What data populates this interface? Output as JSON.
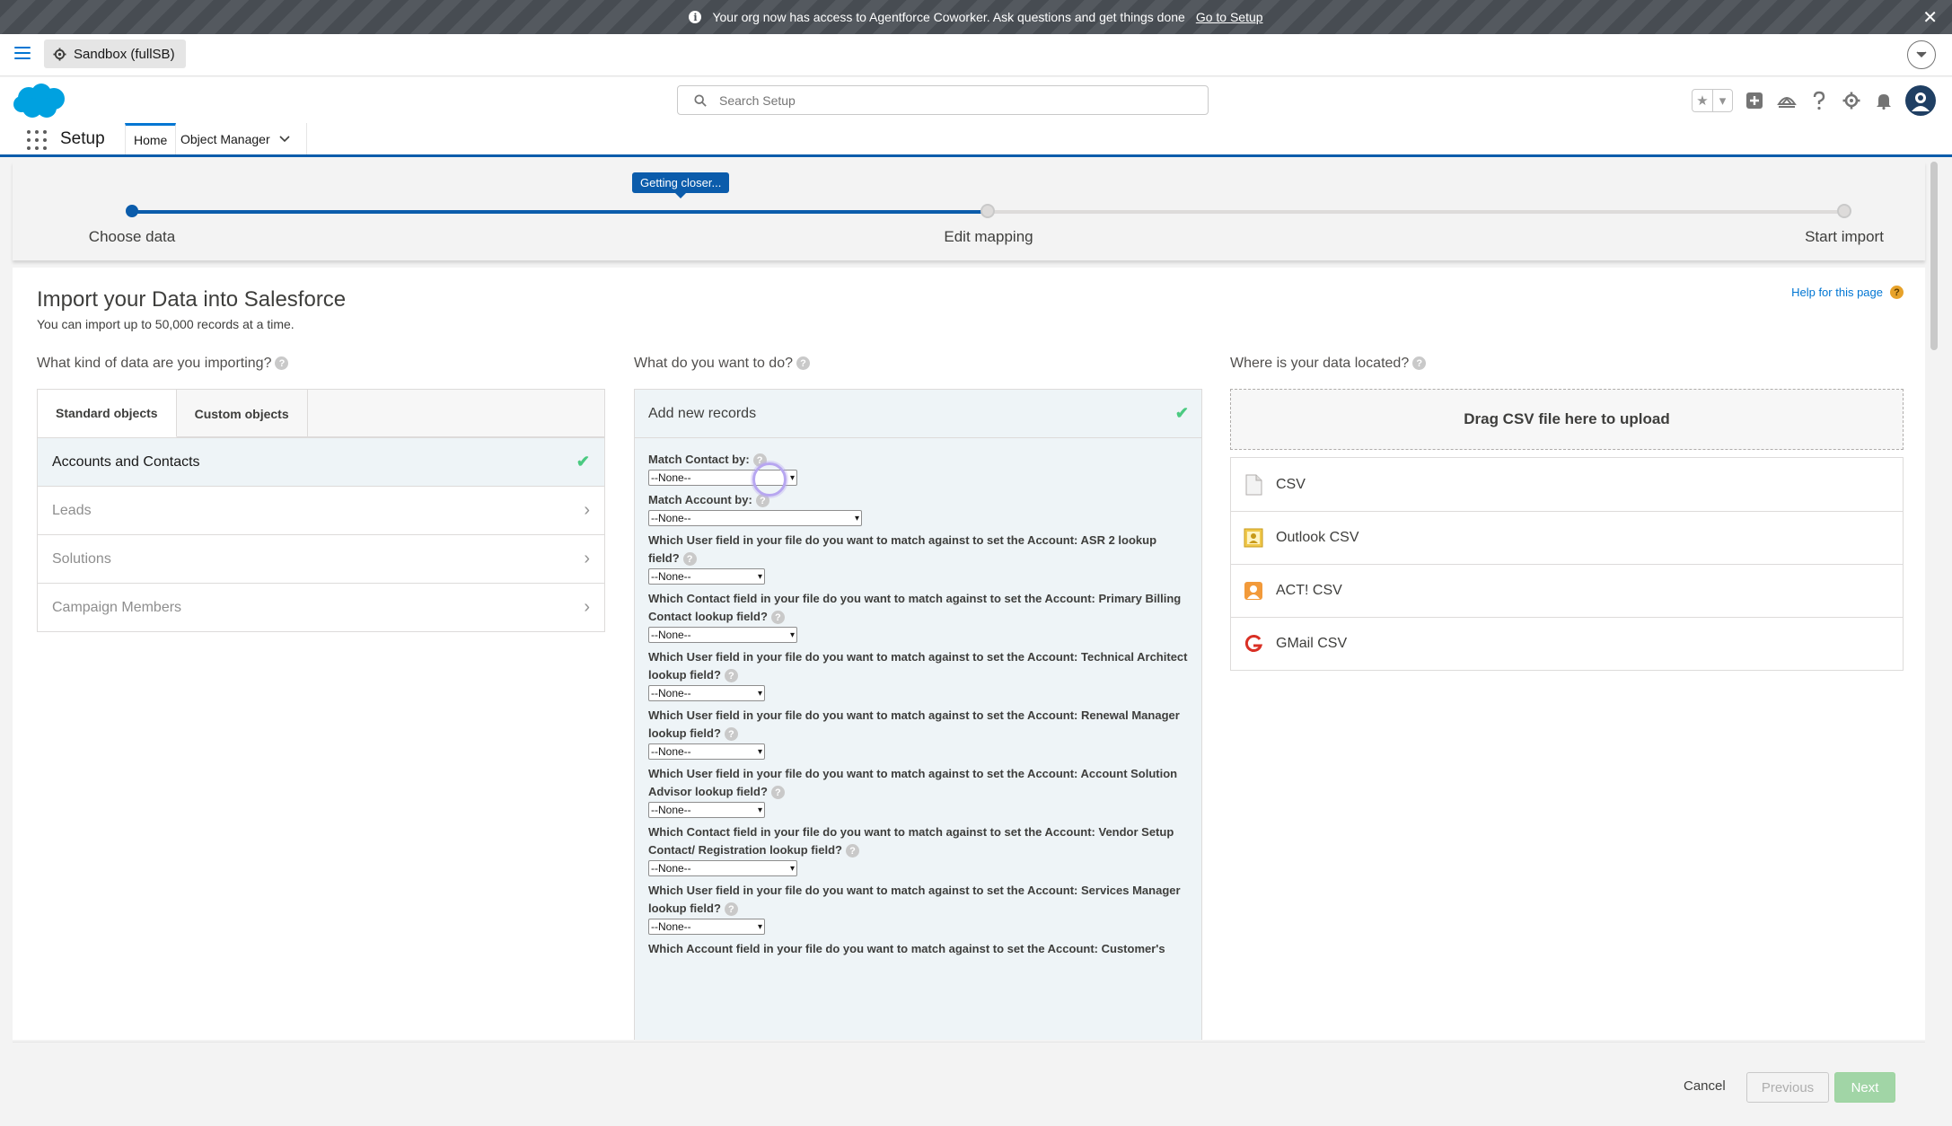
{
  "banner": {
    "message": "Your org now has access to Agentforce Coworker. Ask questions and get things done",
    "link": "Go to Setup"
  },
  "sandbox": {
    "label": "Sandbox (fullSB)"
  },
  "search": {
    "placeholder": "Search Setup"
  },
  "nav": {
    "app_name": "Setup",
    "home": "Home",
    "object_manager": "Object Manager"
  },
  "progress": {
    "tooltip": "Getting closer...",
    "fraction_complete": 0.5,
    "steps": [
      {
        "label": "Choose data"
      },
      {
        "label": "Edit mapping"
      },
      {
        "label": "Start import"
      }
    ]
  },
  "page": {
    "title": "Import your Data into Salesforce",
    "subtitle": "You can import up to 50,000 records at a time.",
    "help": "Help for this page"
  },
  "col1": {
    "question": "What kind of data are you importing?",
    "tabs": [
      "Standard objects",
      "Custom objects"
    ],
    "objects": [
      "Accounts and Contacts",
      "Leads",
      "Solutions",
      "Campaign Members"
    ]
  },
  "col2": {
    "question": "What do you want to do?",
    "action": "Add new records",
    "fields": [
      {
        "label": "Match Contact by:",
        "value": "--None--"
      },
      {
        "label": "Match Account by:",
        "value": "--None--"
      },
      {
        "label": "Which User field in your file do you want to match against to set the Account: ASR 2 lookup field?",
        "value": "--None--"
      },
      {
        "label": "Which Contact field in your file do you want to match against to set the Account: Primary Billing Contact lookup field?",
        "value": "--None--"
      },
      {
        "label": "Which User field in your file do you want to match against to set the Account: Technical Architect lookup field?",
        "value": "--None--"
      },
      {
        "label": "Which User field in your file do you want to match against to set the Account: Renewal Manager lookup field?",
        "value": "--None--"
      },
      {
        "label": "Which User field in your file do you want to match against to set the Account: Account Solution Advisor lookup field?",
        "value": "--None--"
      },
      {
        "label": "Which Contact field in your file do you want to match against to set the Account: Vendor Setup Contact/ Registration lookup field?",
        "value": "--None--"
      },
      {
        "label": "Which User field in your file do you want to match against to set the Account: Services Manager lookup field?",
        "value": "--None--"
      },
      {
        "label": "Which Account field in your file do you want to match against to set the Account: Customer's"
      }
    ]
  },
  "col3": {
    "question": "Where is your data located?",
    "dropzone": "Drag CSV file here to upload",
    "sources": [
      "CSV",
      "Outlook CSV",
      "ACT! CSV",
      "GMail CSV"
    ]
  },
  "footer": {
    "cancel": "Cancel",
    "previous": "Previous",
    "next": "Next"
  },
  "colors": {
    "brand": "#0176d3",
    "progress": "#0b5cab",
    "check": "#4bca81",
    "next_disabled": "#a1d5a6"
  }
}
